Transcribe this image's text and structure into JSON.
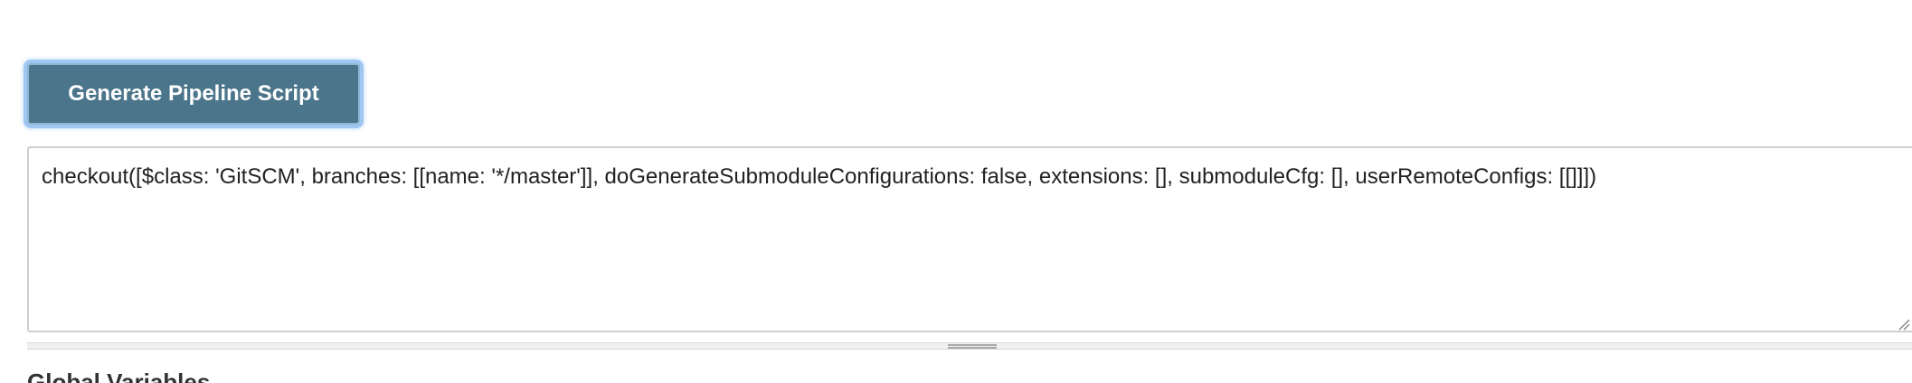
{
  "actions": {
    "generate_button_label": "Generate Pipeline Script"
  },
  "snippet": {
    "value": "checkout([$class: 'GitSCM', branches: [[name: '*/master']], doGenerateSubmoduleConfigurations: false, extensions: [], submoduleCfg: [], userRemoteConfigs: [[]]])"
  },
  "sections": {
    "global_variables_heading": "Global Variables"
  },
  "colors": {
    "button_background": "#4b758b",
    "button_focus_ring": "#9ec7f2",
    "textarea_border": "#cfcfcf"
  },
  "icons": {
    "resize_grip": "resize-grip-icon",
    "splitter_handle": "drag-handle-icon"
  }
}
